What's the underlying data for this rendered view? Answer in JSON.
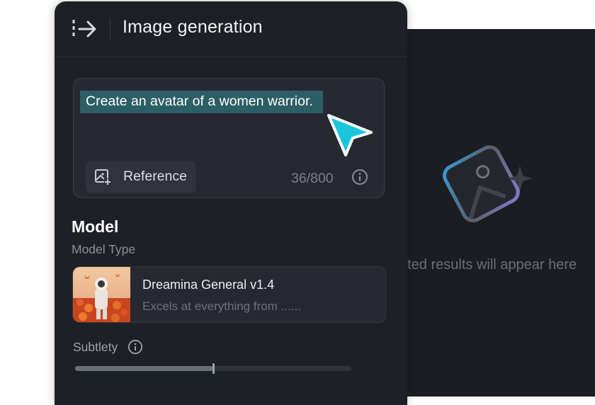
{
  "results": {
    "placeholder_text": "ated results will appear here",
    "placeholder_icon": "image-placeholder-icon"
  },
  "panel": {
    "title": "Image generation",
    "collapse_icon": "collapse-panel-icon"
  },
  "prompt": {
    "text": "Create an avatar of a women warrior.",
    "reference_label": "Reference",
    "reference_icon": "add-image-icon",
    "char_count": "36/800",
    "info_icon": "info-icon",
    "highlight_color": "#2c5e66",
    "cursor_color": "#1ac6dc"
  },
  "model": {
    "heading": "Model",
    "type_label": "Model Type",
    "name": "Dreamina General v1.4",
    "description": "Excels at everything from ......"
  },
  "subtlety": {
    "label": "Subtlety",
    "value_fraction": 0.5
  }
}
